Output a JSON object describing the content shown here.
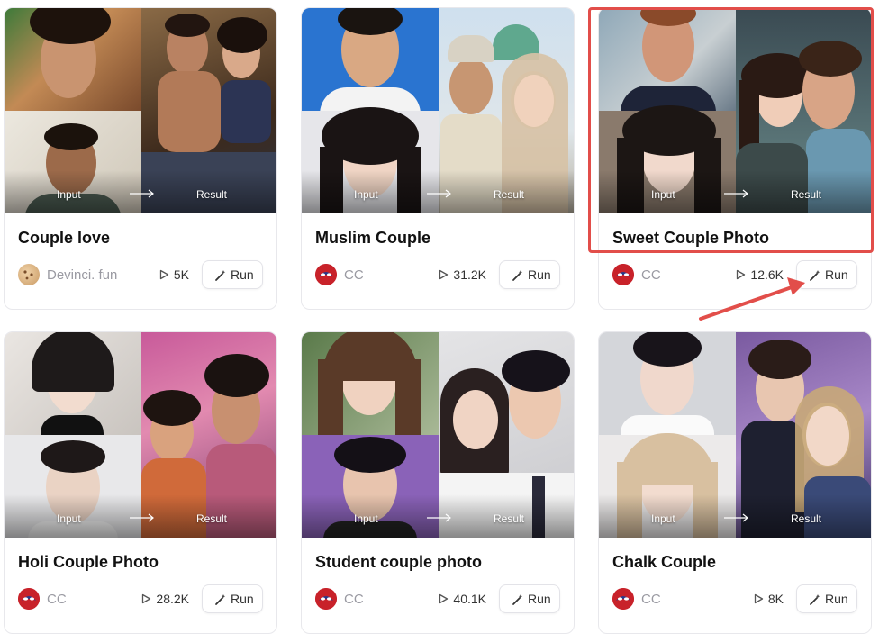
{
  "cards": [
    {
      "title": "Couple love",
      "author": "Devinci. fun",
      "plays": "5K",
      "run_label": "Run",
      "input_label": "Input",
      "result_label": "Result",
      "avatar": "cookie-avatar"
    },
    {
      "title": "Muslim Couple",
      "author": "CC",
      "plays": "31.2K",
      "run_label": "Run",
      "input_label": "Input",
      "result_label": "Result",
      "avatar": "spider-avatar"
    },
    {
      "title": "Sweet Couple Photo",
      "author": "CC",
      "plays": "12.6K",
      "run_label": "Run",
      "input_label": "Input",
      "result_label": "Result",
      "avatar": "spider-avatar"
    },
    {
      "title": "Holi Couple Photo",
      "author": "CC",
      "plays": "28.2K",
      "run_label": "Run",
      "input_label": "Input",
      "result_label": "Result",
      "avatar": "spider-avatar"
    },
    {
      "title": "Student couple photo",
      "author": "CC",
      "plays": "40.1K",
      "run_label": "Run",
      "input_label": "Input",
      "result_label": "Result",
      "avatar": "spider-avatar"
    },
    {
      "title": "Chalk Couple",
      "author": "CC",
      "plays": "8K",
      "run_label": "Run",
      "input_label": "Input",
      "result_label": "Result",
      "avatar": "spider-avatar"
    }
  ],
  "colors": {
    "highlight": "#e24e4a",
    "card_border": "#e8e8ec",
    "muted_text": "#9a9aa2"
  }
}
